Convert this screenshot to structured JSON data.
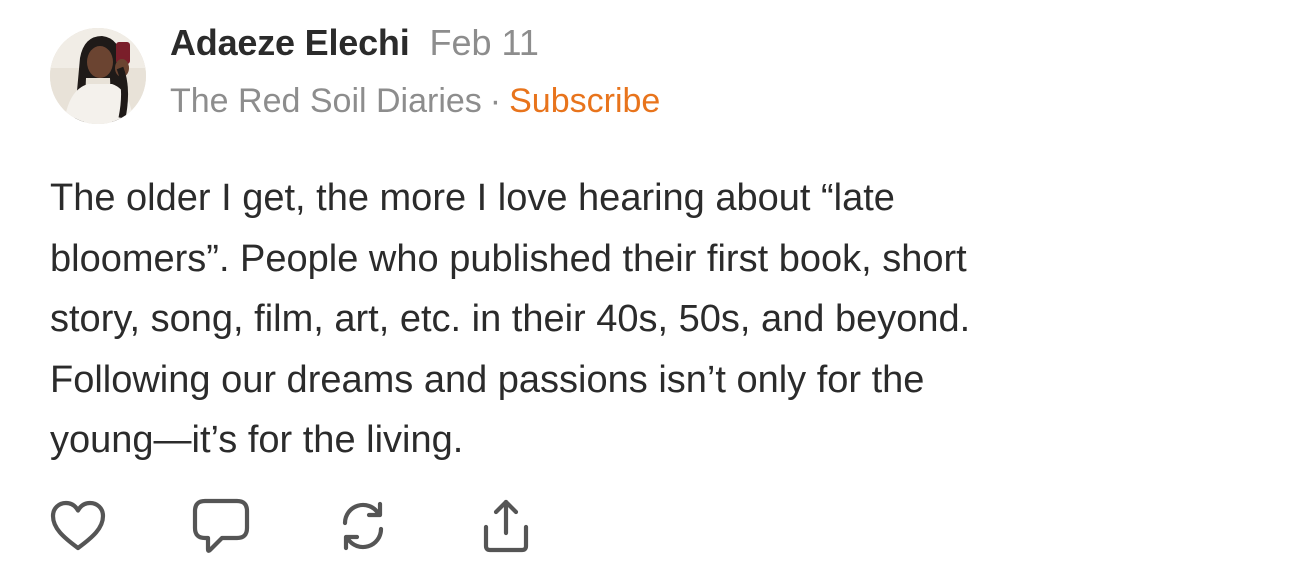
{
  "post": {
    "author": {
      "name": "Adaeze Elechi",
      "avatar": "profile-photo"
    },
    "date": "Feb 11",
    "publication": {
      "name": "The Red Soil Diaries",
      "separator": "·",
      "subscribe_label": "Subscribe"
    },
    "body": "The older I get, the more I love hearing about “late\nbloomers”. People who published their first book, short\nstory, song, film, art, etc. in their 40s, 50s, and beyond.\nFollowing our dreams and passions isn’t only for the\nyoung—it’s for the living.",
    "actions": [
      {
        "icon": "heart-icon"
      },
      {
        "icon": "comment-icon"
      },
      {
        "icon": "restack-icon"
      },
      {
        "icon": "share-icon"
      }
    ]
  },
  "colors": {
    "text": "#2b2b2b",
    "muted": "#8d8d8d",
    "accent": "#e8741c",
    "icon": "#555555"
  }
}
